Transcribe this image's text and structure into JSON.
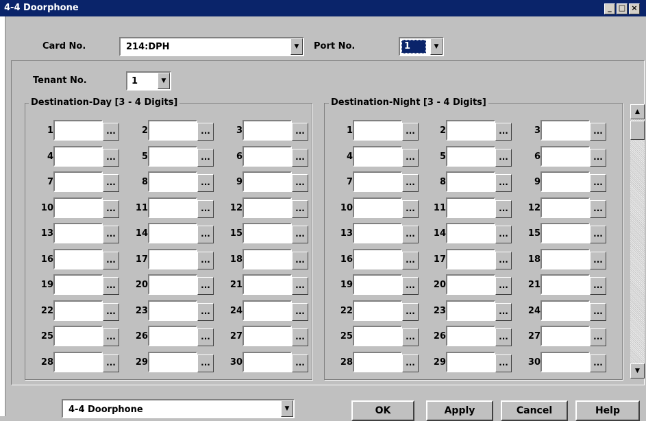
{
  "window": {
    "title": "4-4 Doorphone",
    "controls": [
      {
        "name": "minimize-button",
        "glyph": "_"
      },
      {
        "name": "maximize-button",
        "glyph": "□"
      },
      {
        "name": "close-button",
        "glyph": "×"
      }
    ]
  },
  "header": {
    "card_label": "Card No.",
    "card_value": "214:DPH",
    "port_label": "Port No.",
    "port_value": "1"
  },
  "tenant": {
    "label": "Tenant No.",
    "value": "1"
  },
  "day_group": {
    "title": "Destination-Day [3 - 4 Digits]",
    "entries": [
      "1",
      "2",
      "3",
      "4",
      "5",
      "6",
      "7",
      "8",
      "9",
      "10",
      "11",
      "12",
      "13",
      "14",
      "15",
      "16",
      "17",
      "18",
      "19",
      "20",
      "21",
      "22",
      "23",
      "24",
      "25",
      "26",
      "27",
      "28",
      "29",
      "30"
    ]
  },
  "night_group": {
    "title": "Destination-Night [3 - 4 Digits]",
    "entries": [
      "1",
      "2",
      "3",
      "4",
      "5",
      "6",
      "7",
      "8",
      "9",
      "10",
      "11",
      "12",
      "13",
      "14",
      "15",
      "16",
      "17",
      "18",
      "19",
      "20",
      "21",
      "22",
      "23",
      "24",
      "25",
      "26",
      "27",
      "28",
      "29",
      "30"
    ]
  },
  "field_button_label": "...",
  "dropdown_glyph": "▼",
  "scrollbar": {
    "up_glyph": "▲",
    "down_glyph": "▼"
  },
  "footer": {
    "screen_select_value": "4-4 Doorphone",
    "ok_label": "OK",
    "apply_label": "Apply",
    "cancel_label": "Cancel",
    "help_label": "Help"
  },
  "colors": {
    "titlebar": "#0a246a",
    "face": "#c0c0c0",
    "selection": "#0a246a"
  }
}
